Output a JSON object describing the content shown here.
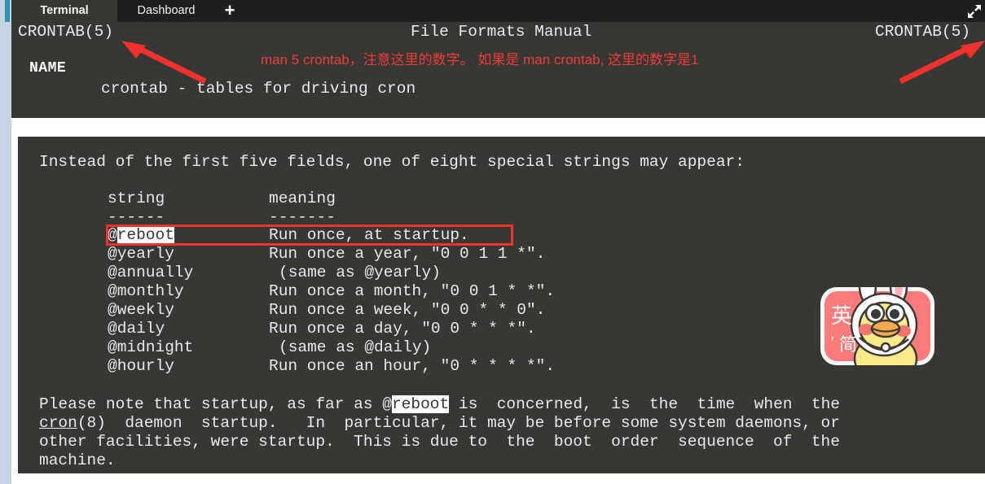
{
  "window": {
    "tabs": [
      {
        "label": "Terminal",
        "active": true
      },
      {
        "label": "Dashboard",
        "active": false
      }
    ],
    "new_tab_label": "+",
    "expand_icon": "expand-arrows-icon",
    "colors": {
      "terminal_bg": "#373733",
      "tabbar_bg": "#1e1e1e",
      "text": "#e6eaf0",
      "annotation_red": "#ef3b36",
      "highlight_bg": "#ffffff",
      "page_rail": "#c6d3e5",
      "accent_teal": "#2a94b5"
    }
  },
  "manpage": {
    "header_left": "CRONTAB(5)",
    "header_center": "File Formats Manual",
    "header_right": "CRONTAB(5)",
    "section_name_heading": "NAME",
    "section_name_body": "crontab - tables for driving cron"
  },
  "annotation": {
    "chinese_note": "man 5 crontab，注意这里的数字。 如果是 man crontab, 这里的数字是1",
    "arrow_left": "red-arrow-up-left-icon",
    "arrow_right": "red-arrow-up-right-icon",
    "red_box": "red-highlight-box"
  },
  "body": {
    "intro": "Instead of the first five fields, one of eight special strings may appear:",
    "col_header_string": "string",
    "col_header_meaning": "meaning",
    "rule_string": "------",
    "rule_meaning": "-------",
    "rows": [
      {
        "string_prefix": "@",
        "string_hl": "reboot",
        "meaning": "Run once, at startup."
      },
      {
        "string_prefix": "@yearly",
        "string_hl": "",
        "meaning": "Run once a year, \"0 0 1 1 *\"."
      },
      {
        "string_prefix": "@annually",
        "string_hl": "",
        "meaning": "(same as @yearly)"
      },
      {
        "string_prefix": "@monthly",
        "string_hl": "",
        "meaning": "Run once a month, \"0 0 1 * *\"."
      },
      {
        "string_prefix": "@weekly",
        "string_hl": "",
        "meaning": "Run once a week, \"0 0 * * 0\"."
      },
      {
        "string_prefix": "@daily",
        "string_hl": "",
        "meaning": "Run once a day, \"0 0 * * *\"."
      },
      {
        "string_prefix": "@midnight",
        "string_hl": "",
        "meaning": "(same as @daily)"
      },
      {
        "string_prefix": "@hourly",
        "string_hl": "",
        "meaning": "Run once an hour, \"0 * * * *\"."
      }
    ],
    "note_1a": "Please note that startup, as far as @",
    "note_1hl": "reboot",
    "note_1b": " is  concerned,  is  the  time  when  the",
    "note_2link": "cron",
    "note_2a": "(8)  daemon  startup.   In  particular, it may be before some system daemons, or",
    "note_3": "other facilities, were startup.  This is due to  the  boot  order  sequence  of  the",
    "note_4": "machine."
  },
  "sticker": {
    "name": "duck-bunny-sticker",
    "char_top": "英",
    "char_bottom": "简",
    "comma": "，"
  }
}
